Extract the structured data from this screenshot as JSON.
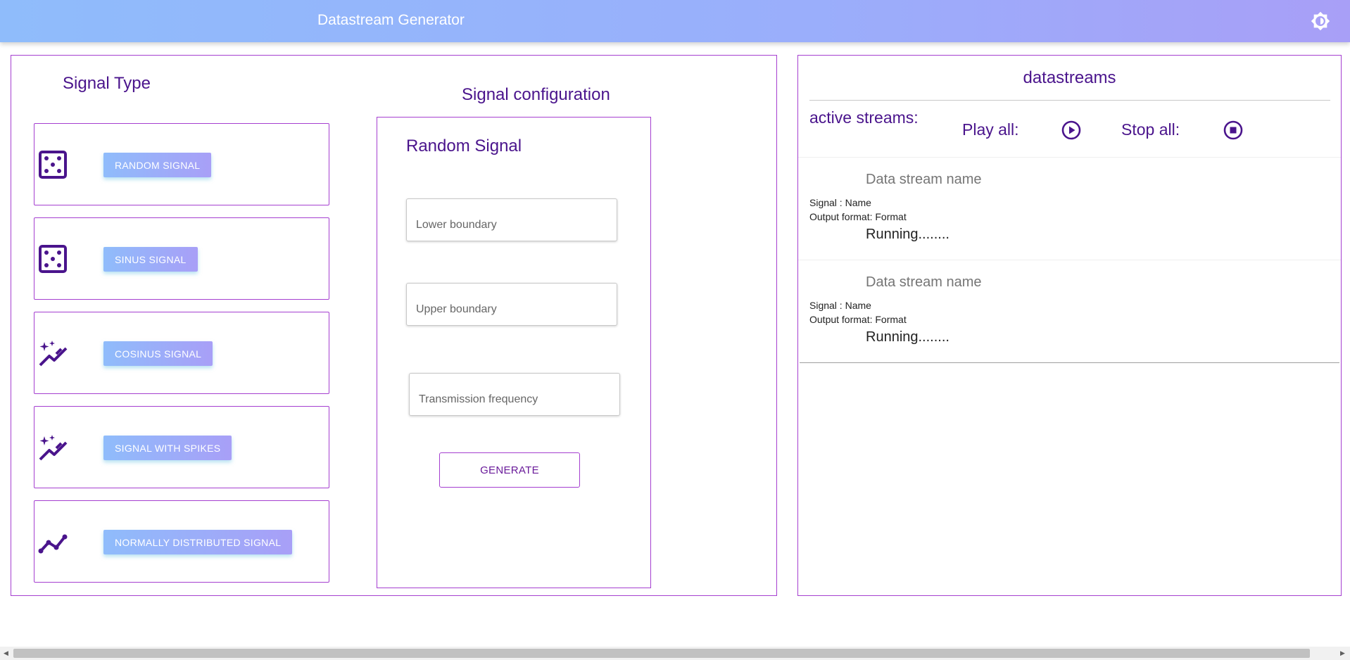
{
  "header": {
    "title": "Datastream Generator",
    "theme_icon": "brightness-icon"
  },
  "signal_type": {
    "title": "Signal Type",
    "cards": [
      {
        "label": "RANDOM SIGNAL",
        "icon": "dice-icon"
      },
      {
        "label": "SINUS SIGNAL",
        "icon": "dice-icon"
      },
      {
        "label": "COSINUS SIGNAL",
        "icon": "sparkle-chart-icon"
      },
      {
        "label": "SIGNAL WITH SPIKES",
        "icon": "sparkle-chart-icon"
      },
      {
        "label": "NORMALLY DISTRIBUTED SIGNAL",
        "icon": "line-chart-icon"
      }
    ]
  },
  "signal_config": {
    "title": "Signal configuration",
    "selected_signal": "Random Signal",
    "lower_placeholder": "Lower boundary",
    "upper_placeholder": "Upper boundary",
    "frequency_placeholder": "Transmission frequency",
    "generate_label": "GENERATE"
  },
  "datastreams": {
    "title": "datastreams",
    "active_label": "active streams:",
    "play_all_label": "Play all:",
    "stop_all_label": "Stop all:",
    "streams": [
      {
        "name": "Data stream name",
        "signal": "Signal : Name",
        "format": "Output format: Format",
        "status": "Running........"
      },
      {
        "name": "Data stream name",
        "signal": "Signal : Name",
        "format": "Output format: Format",
        "status": "Running........"
      }
    ]
  },
  "colors": {
    "accent": "#4a148c",
    "border": "#a53fd0",
    "gradient_start": "#8fbcfb",
    "gradient_end": "#a89ff7"
  }
}
